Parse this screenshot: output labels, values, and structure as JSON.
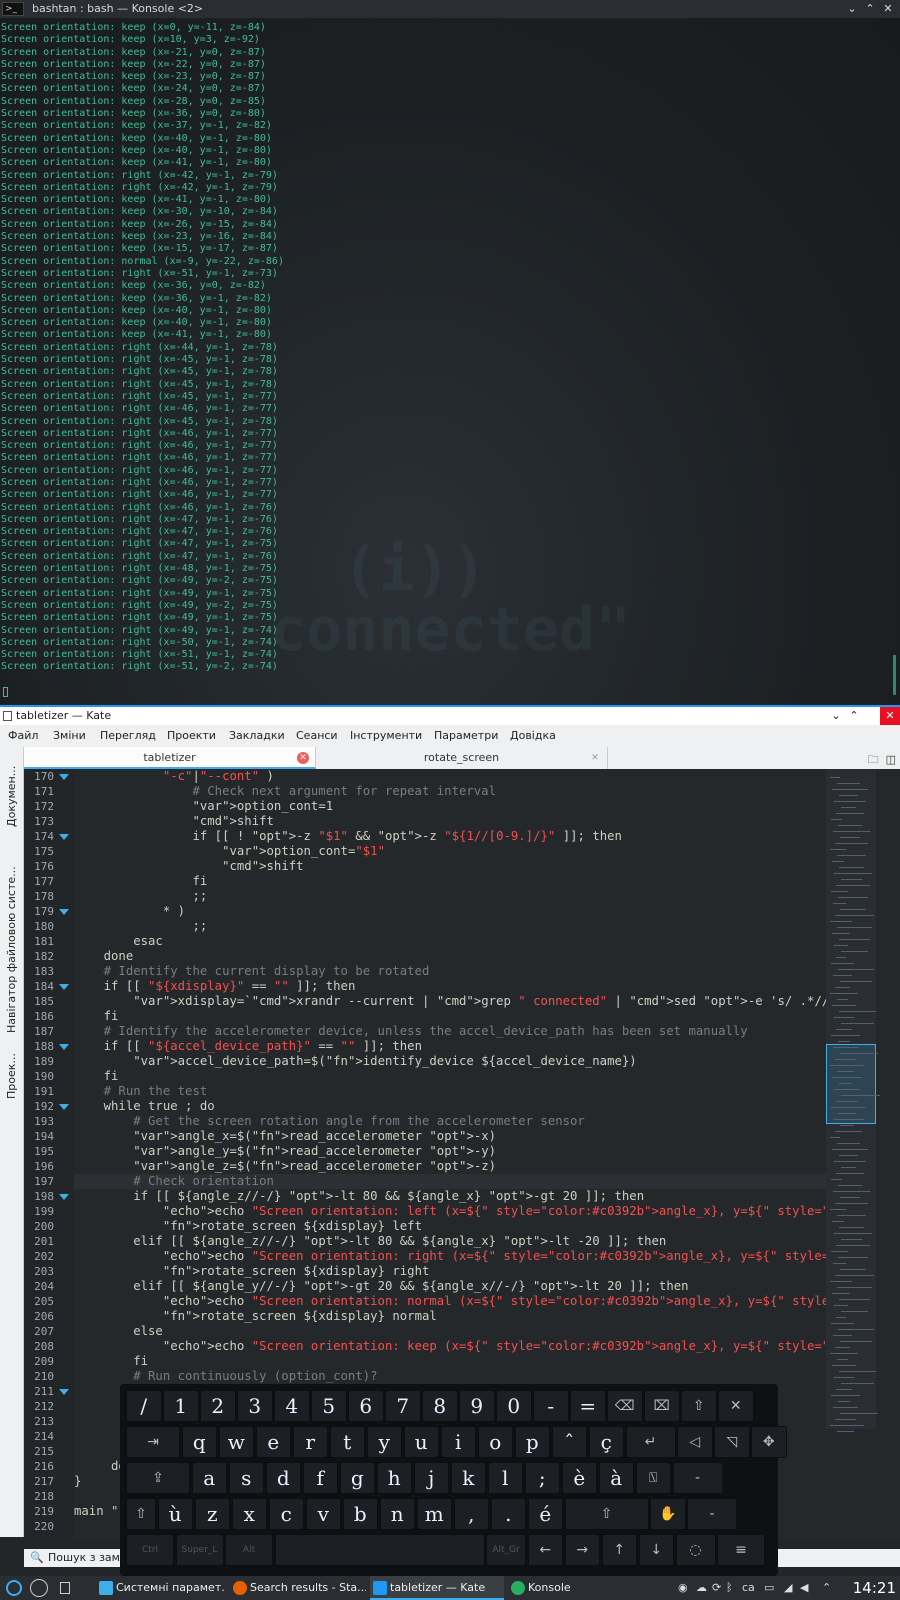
{
  "konsole": {
    "title": "bashtan : bash — Konsole <2>",
    "lines": [
      "Screen orientation: keep (x=0, y=-11, z=-84)",
      "Screen orientation: keep (x=10, y=3, z=-92)",
      "Screen orientation: keep (x=-21, y=0, z=-87)",
      "Screen orientation: keep (x=-22, y=0, z=-87)",
      "Screen orientation: keep (x=-23, y=0, z=-87)",
      "Screen orientation: keep (x=-24, y=0, z=-87)",
      "Screen orientation: keep (x=-28, y=0, z=-85)",
      "Screen orientation: keep (x=-36, y=0, z=-80)",
      "Screen orientation: keep (x=-37, y=-1, z=-82)",
      "Screen orientation: keep (x=-40, y=-1, z=-80)",
      "Screen orientation: keep (x=-40, y=-1, z=-80)",
      "Screen orientation: keep (x=-41, y=-1, z=-80)",
      "Screen orientation: right (x=-42, y=-1, z=-79)",
      "Screen orientation: right (x=-42, y=-1, z=-79)",
      "Screen orientation: keep (x=-41, y=-1, z=-80)",
      "Screen orientation: keep (x=-30, y=-10, z=-84)",
      "Screen orientation: keep (x=-26, y=-15, z=-84)",
      "Screen orientation: keep (x=-23, y=-16, z=-84)",
      "Screen orientation: keep (x=-15, y=-17, z=-87)",
      "Screen orientation: normal (x=-9, y=-22, z=-86)",
      "Screen orientation: right (x=-51, y=-1, z=-73)",
      "Screen orientation: keep (x=-36, y=0, z=-82)",
      "Screen orientation: keep (x=-36, y=-1, z=-82)",
      "Screen orientation: keep (x=-40, y=-1, z=-80)",
      "Screen orientation: keep (x=-40, y=-1, z=-80)",
      "Screen orientation: keep (x=-41, y=-1, z=-80)",
      "Screen orientation: right (x=-44, y=-1, z=-78)",
      "Screen orientation: right (x=-45, y=-1, z=-78)",
      "Screen orientation: right (x=-45, y=-1, z=-78)",
      "Screen orientation: right (x=-45, y=-1, z=-78)",
      "Screen orientation: right (x=-45, y=-1, z=-77)",
      "Screen orientation: right (x=-46, y=-1, z=-77)",
      "Screen orientation: right (x=-45, y=-1, z=-78)",
      "Screen orientation: right (x=-46, y=-1, z=-77)",
      "Screen orientation: right (x=-46, y=-1, z=-77)",
      "Screen orientation: right (x=-46, y=-1, z=-77)",
      "Screen orientation: right (x=-46, y=-1, z=-77)",
      "Screen orientation: right (x=-46, y=-1, z=-77)",
      "Screen orientation: right (x=-46, y=-1, z=-77)",
      "Screen orientation: right (x=-46, y=-1, z=-76)",
      "Screen orientation: right (x=-47, y=-1, z=-76)",
      "Screen orientation: right (x=-47, y=-1, z=-76)",
      "Screen orientation: right (x=-47, y=-1, z=-75)",
      "Screen orientation: right (x=-47, y=-1, z=-76)",
      "Screen orientation: right (x=-48, y=-1, z=-75)",
      "Screen orientation: right (x=-49, y=-2, z=-75)",
      "Screen orientation: right (x=-49, y=-1, z=-75)",
      "Screen orientation: right (x=-49, y=-2, z=-75)",
      "Screen orientation: right (x=-49, y=-1, z=-75)",
      "Screen orientation: right (x=-49, y=-1, z=-74)",
      "Screen orientation: right (x=-50, y=-1, z=-74)",
      "Screen orientation: right (x=-51, y=-1, z=-74)",
      "Screen orientation: right (x=-51, y=-2, z=-74)"
    ]
  },
  "kate": {
    "title": "tabletizer — Kate",
    "menu": [
      "Файл",
      "Зміни",
      "Перегляд",
      "Проекти",
      "Закладки",
      "Сеанси",
      "Інструменти",
      "Параметри",
      "Довідка"
    ],
    "tabs": [
      {
        "label": "tabletizer",
        "active": true
      },
      {
        "label": "rotate_screen",
        "active": false
      }
    ],
    "side_tabs": [
      "Докумен...",
      "Навігатор файловою систе...",
      "Проек..."
    ],
    "search_label": "Пошук з зами",
    "code": [
      {
        "n": "170",
        "fold": true,
        "t": "            \"-c\"|\"--cont\" )"
      },
      {
        "n": "171",
        "t": "                # Check next argument for repeat interval"
      },
      {
        "n": "172",
        "t": "                option_cont=1"
      },
      {
        "n": "173",
        "t": "                shift"
      },
      {
        "n": "174",
        "fold": true,
        "t": "                if [[ ! -z \"$1\" && -z \"${1//[0-9.]/}\" ]]; then"
      },
      {
        "n": "175",
        "t": "                    option_cont=\"$1\""
      },
      {
        "n": "176",
        "t": "                    shift"
      },
      {
        "n": "177",
        "t": "                fi"
      },
      {
        "n": "178",
        "t": "                ;;"
      },
      {
        "n": "179",
        "fold": true,
        "t": "            * )"
      },
      {
        "n": "180",
        "t": "                ;;"
      },
      {
        "n": "181",
        "t": "        esac"
      },
      {
        "n": "182",
        "t": "    done"
      },
      {
        "n": "183",
        "t": "    # Identify the current display to be rotated"
      },
      {
        "n": "184",
        "fold": true,
        "t": "    if [[ \"${xdisplay}\" == \"\" ]]; then"
      },
      {
        "n": "185",
        "t": "        xdisplay=`xrandr --current | grep \" connected\" | sed -e 's/ .*//g'`"
      },
      {
        "n": "186",
        "t": "    fi"
      },
      {
        "n": "187",
        "t": "    # Identify the accelerometer device, unless the accel_device_path has been set manually"
      },
      {
        "n": "188",
        "fold": true,
        "t": "    if [[ \"${accel_device_path}\" == \"\" ]]; then"
      },
      {
        "n": "189",
        "t": "        accel_device_path=$(identify_device ${accel_device_name})"
      },
      {
        "n": "190",
        "t": "    fi"
      },
      {
        "n": "191",
        "t": "    # Run the test"
      },
      {
        "n": "192",
        "fold": true,
        "t": "    while true ; do"
      },
      {
        "n": "193",
        "t": "        # Get the screen rotation angle from the accelerometer sensor"
      },
      {
        "n": "194",
        "t": "        angle_x=$(read_accelerometer -x)"
      },
      {
        "n": "195",
        "t": "        angle_y=$(read_accelerometer -y)"
      },
      {
        "n": "196",
        "t": "        angle_z=$(read_accelerometer -z)"
      },
      {
        "n": "197",
        "cur": true,
        "t": "        # Check orientation"
      },
      {
        "n": "198",
        "fold": true,
        "t": "        if [[ ${angle_z//-/} -lt 80 && ${angle_x} -gt 20 ]]; then"
      },
      {
        "n": "199",
        "t": "            echo \"Screen orientation: left (x=${angle_x}, y=${angle_y}, z=${angle_z})\""
      },
      {
        "n": "200",
        "t": "            rotate_screen ${xdisplay} left"
      },
      {
        "n": "201",
        "t": "        elif [[ ${angle_z//-/} -lt 80 && ${angle_x} -lt -20 ]]; then"
      },
      {
        "n": "202",
        "t": "            echo \"Screen orientation: right (x=${angle_x}, y=${angle_y}, z=${angle_z})\""
      },
      {
        "n": "203",
        "t": "            rotate_screen ${xdisplay} right"
      },
      {
        "n": "204",
        "t": "        elif [[ ${angle_y//-/} -gt 20 && ${angle_x//-/} -lt 20 ]]; then"
      },
      {
        "n": "205",
        "t": "            echo \"Screen orientation: normal (x=${angle_x}, y=${angle_y}, z=${angle_z})\""
      },
      {
        "n": "206",
        "t": "            rotate_screen ${xdisplay} normal"
      },
      {
        "n": "207",
        "t": "        else"
      },
      {
        "n": "208",
        "t": "            echo \"Screen orientation: keep (x=${angle_x}, y=${angle_y}, z=${angle_z})\""
      },
      {
        "n": "209",
        "t": "        fi"
      },
      {
        "n": "210",
        "t": "        # Run continuously (option_cont)?"
      },
      {
        "n": "211",
        "fold": true,
        "t": ""
      },
      {
        "n": "212",
        "t": ""
      },
      {
        "n": "213",
        "t": ""
      },
      {
        "n": "214",
        "t": ""
      },
      {
        "n": "215",
        "t": ""
      },
      {
        "n": "216",
        "t": "     do"
      },
      {
        "n": "217",
        "t": "}"
      },
      {
        "n": "218",
        "t": ""
      },
      {
        "n": "219",
        "t": "main \""
      },
      {
        "n": "220",
        "t": ""
      }
    ]
  },
  "keyboard": {
    "row1": [
      "/",
      "1",
      "2",
      "3",
      "4",
      "5",
      "6",
      "7",
      "8",
      "9",
      "0",
      "-",
      "=",
      "⌫",
      "⌧",
      "⇧",
      "✕"
    ],
    "row2": [
      "⇥",
      "q",
      "w",
      "e",
      "r",
      "t",
      "y",
      "u",
      "i",
      "o",
      "p",
      "ˆ",
      "ç",
      "↵",
      "◁",
      "◹",
      "✥"
    ],
    "row3": [
      "⇪",
      "a",
      "s",
      "d",
      "f",
      "g",
      "h",
      "j",
      "k",
      "l",
      ";",
      "è",
      "à",
      "⍂",
      "-"
    ],
    "row4": [
      "⇧",
      "ù",
      "z",
      "x",
      "c",
      "v",
      "b",
      "n",
      "m",
      ",",
      ".",
      "é",
      "⇧",
      "✋",
      "-"
    ],
    "row5": [
      "Ctrl",
      "Super_L",
      "Alt",
      "",
      "Alt_Gr",
      "←",
      "→",
      "↑",
      "↓",
      "◌",
      "≡"
    ]
  },
  "taskbar": {
    "items": [
      {
        "label": "Системні парамет...",
        "color": "#3daee9"
      },
      {
        "label": "Search results - Sta...",
        "color": "#e66000"
      },
      {
        "label": "tabletizer — Kate",
        "color": "#1d99f3",
        "active": true
      },
      {
        "label": "Konsole",
        "color": "#27ae60"
      }
    ],
    "lang": "ca",
    "clock": "14:21"
  }
}
